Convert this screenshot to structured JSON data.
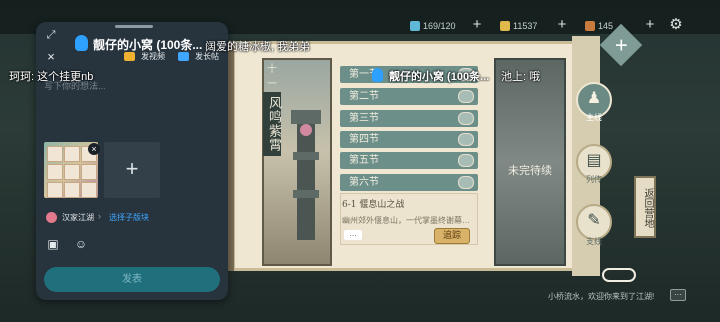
{
  "game": {
    "top_resources": [
      {
        "value": "169/120",
        "color": "#5fb8d7"
      },
      {
        "value": "11537",
        "color": "#e0b84c"
      },
      {
        "value": "145",
        "color": "#c97a3d"
      }
    ],
    "chapter": {
      "number": "十一",
      "title": "风鸣紫霄"
    },
    "sections": [
      {
        "label": "第一节"
      },
      {
        "label": "第二节"
      },
      {
        "label": "第三节"
      },
      {
        "label": "第四节"
      },
      {
        "label": "第五节"
      },
      {
        "label": "第六节"
      }
    ],
    "detail": {
      "title": "6-1 偃息山之战",
      "text": "幽州郊外偃息山，一代掌墨终谢幕…",
      "ellipsis": "…",
      "track_label": "追踪"
    },
    "locked_label": "未完待续",
    "side_tabs": [
      {
        "label": "主线",
        "glyph": "♟",
        "active": true
      },
      {
        "label": "列传",
        "glyph": "▤",
        "active": false
      },
      {
        "label": "支线",
        "glyph": "✎",
        "active": false
      }
    ],
    "back_label": "返回营地",
    "bottom_hint": "小桥流水，欢迎你来到了江湖!",
    "chat_glyph": "···"
  },
  "danmaku": [
    {
      "text": "阔爱的糖冰椒, 我弟弟"
    },
    {
      "text": "珂珂: 这个挂更nb"
    },
    {
      "text": "池上: 哦"
    }
  ],
  "post_panel": {
    "group_name": "靓仔的小窝 (100条...",
    "overlay_group_name": "靓仔的小窝 (100条...",
    "actions": [
      {
        "label": "发视频",
        "color": "#f0b030"
      },
      {
        "label": "发长帖",
        "color": "#3fa7ff"
      }
    ],
    "placeholder": "写下你的想法...",
    "section_name": "汉家江湖",
    "section_choose": "选择子版块",
    "send_label": "发表",
    "add_image_glyph": "+",
    "close_glyph": "×",
    "expand_glyph": "⤢"
  }
}
